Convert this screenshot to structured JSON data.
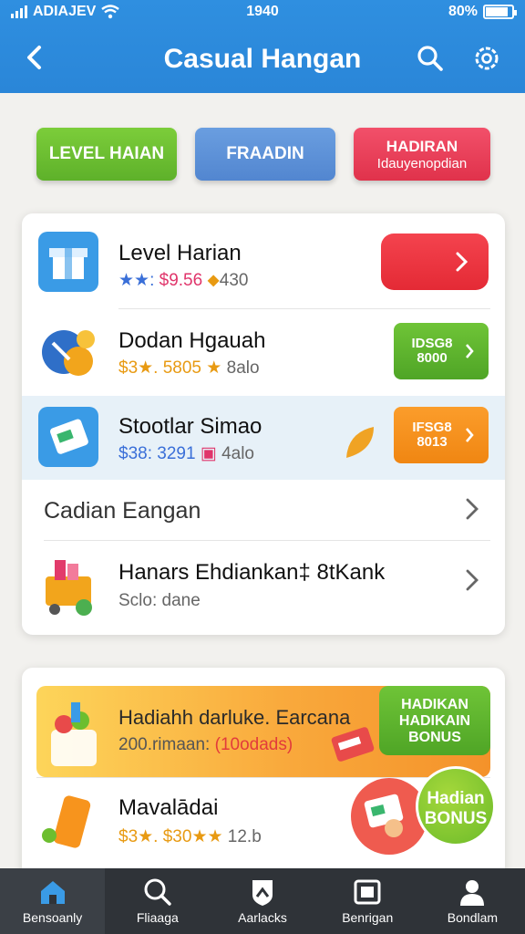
{
  "status": {
    "carrier": "ADIAJEV",
    "time": "1940",
    "battery": "80%",
    "battery_level": 0.9
  },
  "header": {
    "title": "Casual Hangan"
  },
  "segments": [
    {
      "label": "LEVEL HAIAN",
      "sub": ""
    },
    {
      "label": "FRAADIN",
      "sub": ""
    },
    {
      "label": "HADIRAN",
      "sub": "Idauyenopdian"
    }
  ],
  "list": [
    {
      "title": "Level Harian",
      "rating": "★★:",
      "price": "$9.56",
      "points": "430"
    },
    {
      "title": "Dodan Hgauah",
      "rating": "$3★.",
      "price": "5805",
      "points": "8alo",
      "badge": "IDSG8 8000"
    },
    {
      "title": "Stootlar Simao",
      "rating": "$38:",
      "price": "3291",
      "points": "4alo",
      "badge": "IFSG8 8013"
    }
  ],
  "section": {
    "title": "Cadian Eangan"
  },
  "extra_row": {
    "title": "Hanars Ehdiankan‡ 8tKank",
    "subtitle": "Sclo: dane"
  },
  "promo": {
    "title": "Hadiahh darluke. Earcana",
    "amount": "200.rimaan:",
    "highlight": "(10odads)",
    "bonus_badge": [
      "HADIKAN",
      "HADIKAIN",
      "BONUS"
    ]
  },
  "list2": [
    {
      "title": "Mavalādai",
      "rating": "$3★.",
      "price": "$30",
      "stars": "★★",
      "points": "12.b"
    }
  ],
  "bonus_circle": {
    "line1": "Hadian",
    "line2": "BONUS"
  },
  "nav": [
    {
      "label": "Bensoanly",
      "icon": "home-icon"
    },
    {
      "label": "Fliaaga",
      "icon": "search-icon"
    },
    {
      "label": "Aarlacks",
      "icon": "shield-icon"
    },
    {
      "label": "Benrigan",
      "icon": "photo-icon"
    },
    {
      "label": "Bondlam",
      "icon": "profile-icon"
    }
  ],
  "colors": {
    "header": "#2f8fe0",
    "green": "#6cbe2f",
    "blue": "#5a8fd6",
    "red": "#ee3f55",
    "orange": "#f7941d",
    "nav": "#2f3338"
  }
}
